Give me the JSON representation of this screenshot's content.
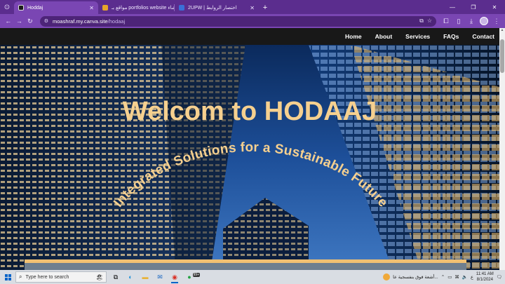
{
  "tabs": [
    {
      "title": "Hoddaj",
      "active": true,
      "favicon_color": "#1b1b1b"
    },
    {
      "title": "مواقع بـ portfolios website انشاء",
      "active": false,
      "favicon_color": "#e6a629"
    },
    {
      "title": "2UPW | اختصار الروابط",
      "active": false,
      "favicon_color": "#3a6fd8"
    }
  ],
  "address": {
    "host": "moashraf.my.canva.site",
    "path": "/hodaaj"
  },
  "site_nav": [
    "Home",
    "About",
    "Services",
    "FAQs",
    "Contact"
  ],
  "hero": {
    "title": "Welcom to HODAAJ",
    "tagline": "Integrated Solutions for a Sustainable Future",
    "text_color": "#f6d08f"
  },
  "taskbar": {
    "search_placeholder": "Type here to search",
    "badge": "99+",
    "weather_text": "أشعة فوق بنفسجية عا...",
    "language": "ع",
    "time": "11:41 AM",
    "date": "8/1/2024"
  },
  "icons": {
    "back": "arrow-left",
    "forward": "arrow-right",
    "reload": "reload",
    "site_info": "site-info",
    "bookmark": "star",
    "extensions": "puzzle",
    "download": "download",
    "menu": "kebab"
  },
  "colors": {
    "tab_strip": "#5b2d8e",
    "toolbar": "#7a46b3",
    "nav_bar": "#181818"
  }
}
